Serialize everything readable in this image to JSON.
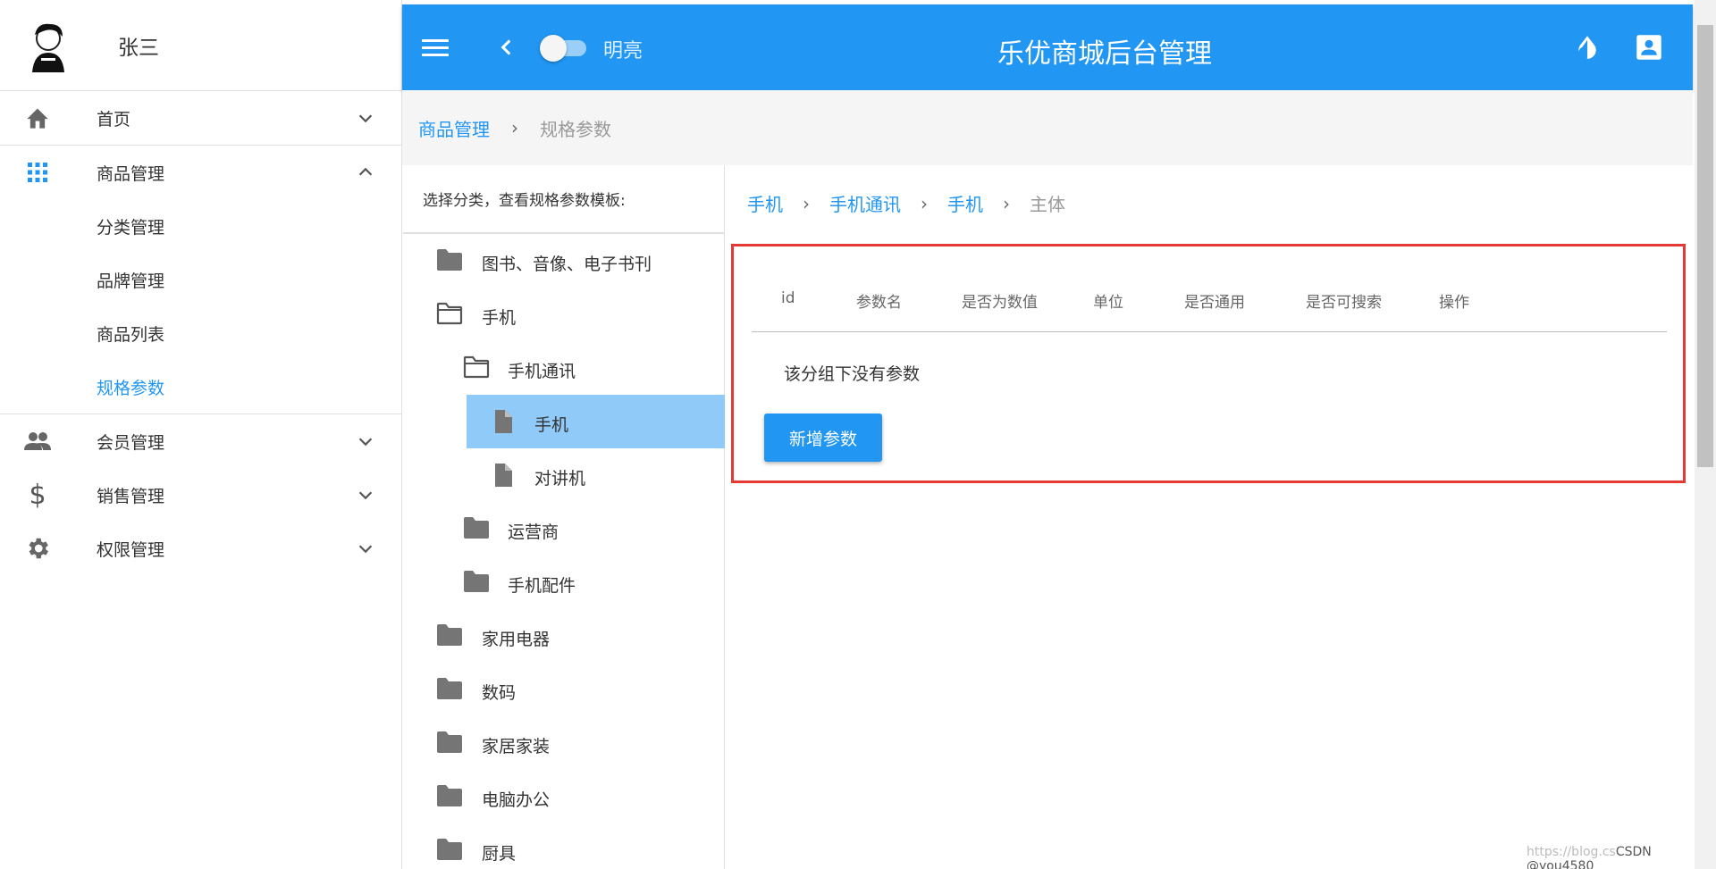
{
  "user": {
    "name": "张三"
  },
  "sidebar": {
    "items": [
      {
        "label": "首页",
        "icon": "home-icon"
      },
      {
        "label": "商品管理",
        "icon": "apps-grid-icon",
        "expanded": true,
        "children": [
          "分类管理",
          "品牌管理",
          "商品列表",
          "规格参数"
        ],
        "active_child": "规格参数"
      },
      {
        "label": "会员管理",
        "icon": "people-icon"
      },
      {
        "label": "销售管理",
        "icon": "dollar-icon"
      },
      {
        "label": "权限管理",
        "icon": "gear-icon"
      }
    ]
  },
  "topbar": {
    "toggle_label": "明亮",
    "title": "乐优商城后台管理"
  },
  "breadcrumb": {
    "parent": "商品管理",
    "current": "规格参数"
  },
  "tree": {
    "heading": "选择分类，查看规格参数模板:",
    "nodes": [
      {
        "label": "图书、音像、电子书刊",
        "level": 0,
        "type": "folder"
      },
      {
        "label": "手机",
        "level": 0,
        "type": "folder-open"
      },
      {
        "label": "手机通讯",
        "level": 1,
        "type": "folder-open"
      },
      {
        "label": "手机",
        "level": 2,
        "type": "file",
        "selected": true
      },
      {
        "label": "对讲机",
        "level": 2,
        "type": "file"
      },
      {
        "label": "运营商",
        "level": 1,
        "type": "folder"
      },
      {
        "label": "手机配件",
        "level": 1,
        "type": "folder"
      },
      {
        "label": "家用电器",
        "level": 0,
        "type": "folder"
      },
      {
        "label": "数码",
        "level": 0,
        "type": "folder"
      },
      {
        "label": "家居家装",
        "level": 0,
        "type": "folder"
      },
      {
        "label": "电脑办公",
        "level": 0,
        "type": "folder"
      },
      {
        "label": "厨具",
        "level": 0,
        "type": "folder"
      }
    ]
  },
  "path": [
    "手机",
    "手机通讯",
    "手机",
    "主体"
  ],
  "params_table": {
    "columns": [
      "id",
      "参数名",
      "是否为数值",
      "单位",
      "是否通用",
      "是否可搜索",
      "操作"
    ],
    "empty_text": "该分组下没有参数",
    "add_button": "新增参数"
  },
  "watermark": {
    "blog": "https://blog.cs",
    "author": "CSDN @you4580"
  },
  "colors": {
    "primary": "#2196f3",
    "selected_bg": "#90caf9",
    "highlight_border": "#e53935"
  }
}
